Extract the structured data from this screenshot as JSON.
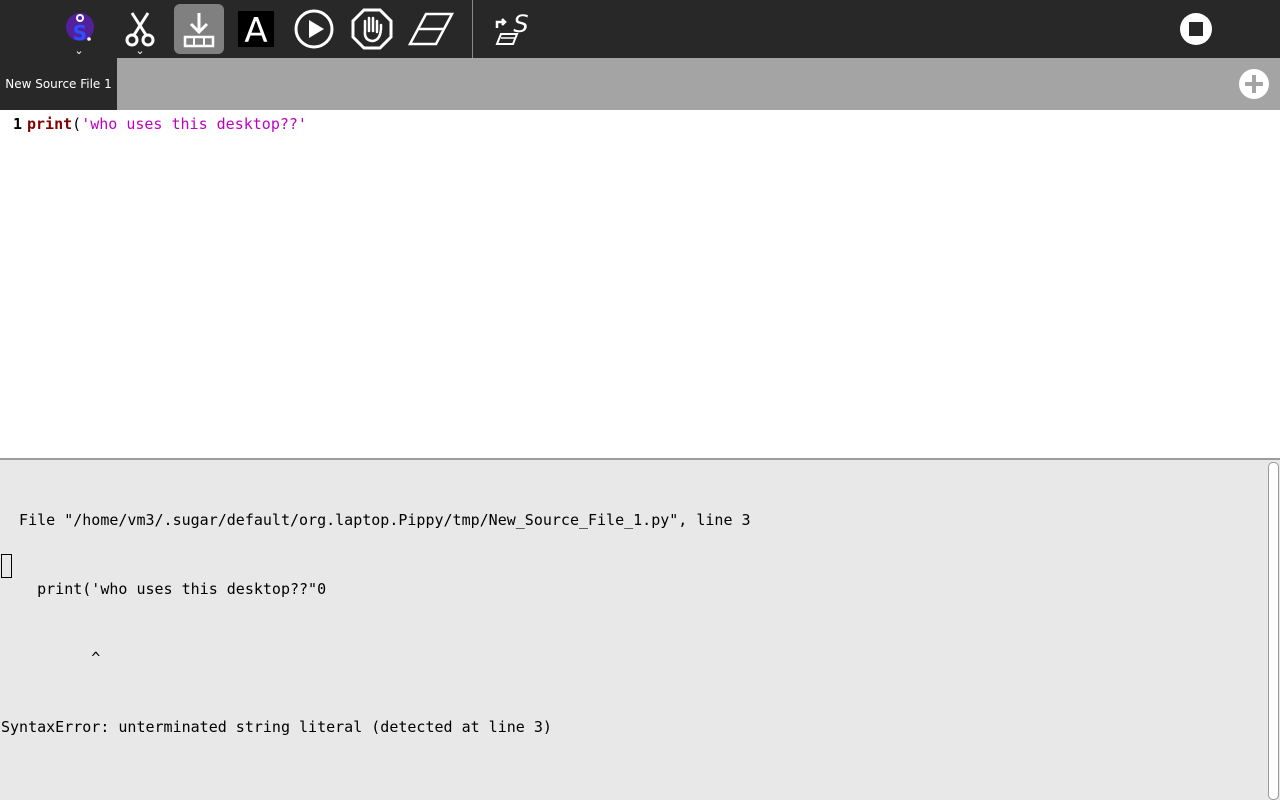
{
  "toolbar": {
    "icons": {
      "activity": "pippy-activity-icon",
      "cut": "scissors-icon",
      "save": "download-icon",
      "font": "letter-a-icon",
      "run": "play-icon",
      "stop_run": "hand-stop-icon",
      "clear": "eraser-icon",
      "export": "export-bundle-icon",
      "stop": "stop-icon"
    },
    "font_glyph": "A"
  },
  "tabs": [
    {
      "label": "New Source File 1"
    }
  ],
  "editor": {
    "lines": [
      {
        "number": "1",
        "keyword": "print",
        "open_paren": "(",
        "string": "'who uses this desktop??'"
      }
    ]
  },
  "console": {
    "lines": [
      "  File \"/home/vm3/.sugar/default/org.laptop.Pippy/tmp/New_Source_File_1.py\", line 3",
      "    print('who uses this desktop??\"0",
      "          ^",
      "SyntaxError: unterminated string literal (detected at line 3)"
    ]
  },
  "colors": {
    "toolbar_bg": "#282828",
    "tabbar_bg": "#a4a4a4",
    "console_bg": "#e8e8e8",
    "keyword": "#800000",
    "string": "#c000c0",
    "activity_accent": "#7a2fd0"
  }
}
